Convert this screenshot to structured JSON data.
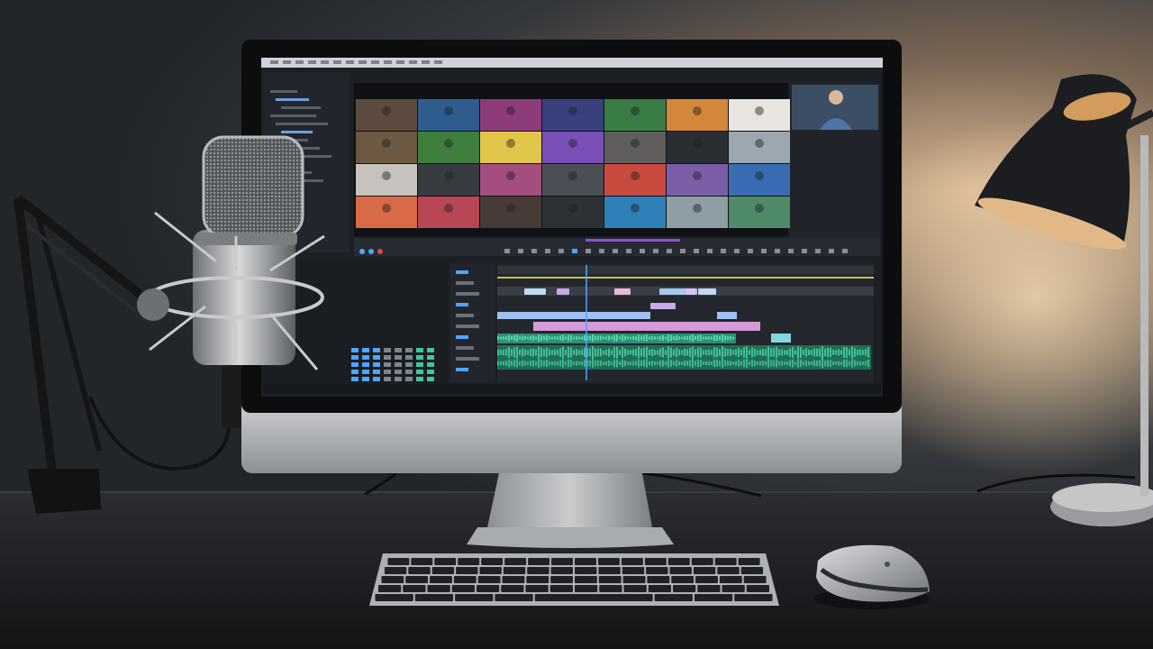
{
  "scene": {
    "colors": {
      "wall_dark": "#24272b",
      "wall_warm": "#d4b08a",
      "desk": "#1b1d20",
      "monitor_silver": "#b9bcbf",
      "bezel": "#0c0d0f",
      "screen_bg": "#1c1f24",
      "lamp_glow": "#f3d2a4",
      "waveform": "#3ec99a",
      "playhead": "#4fa6ff"
    },
    "timeline_clips": {
      "track1_colors": [
        "#bfd9f0",
        "#c9a9e6",
        "#e9b9d6",
        "#a7c7ef",
        "#d6c4f2"
      ],
      "track2_colors": [
        "#9ec0f2",
        "#d59ad8",
        "#f0a8d2"
      ]
    },
    "video_grid": {
      "tile_colors": [
        "#5b4a3d",
        "#2e5c8f",
        "#8e3b7a",
        "#3a3f7d",
        "#3a7c46",
        "#d4873a",
        "#e8e4df",
        "#6d5843",
        "#3f7f3e",
        "#e2c64a",
        "#7a4fb8",
        "#5f5e5c",
        "#2a2d31",
        "#9da7b1",
        "#c6c3bf",
        "#383b40",
        "#a34e7e",
        "#4b4e55",
        "#c94a3f",
        "#7b5ea8",
        "#3a6cb3",
        "#d96a45",
        "#b84654",
        "#473b35",
        "#2e3237",
        "#2f7fb9",
        "#8e9ea4",
        "#4f8a6b"
      ]
    }
  }
}
